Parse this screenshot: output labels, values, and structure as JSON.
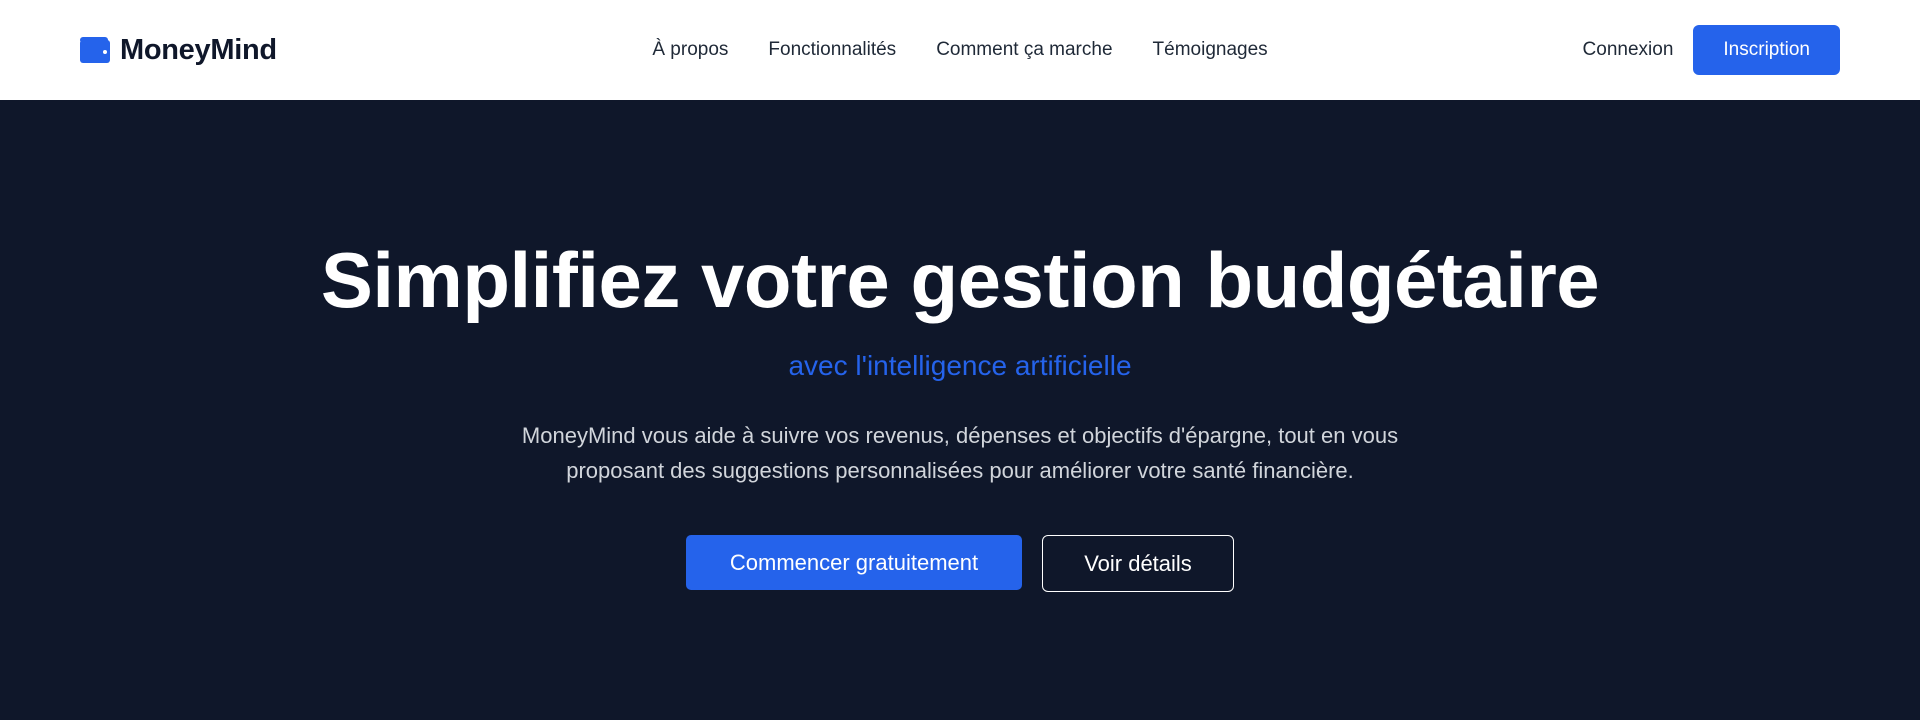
{
  "brand": {
    "name": "MoneyMind",
    "icon": "wallet-icon",
    "color": "#2563eb"
  },
  "nav": {
    "links": [
      {
        "label": "À propos"
      },
      {
        "label": "Fonctionnalités"
      },
      {
        "label": "Comment ça marche"
      },
      {
        "label": "Témoignages"
      }
    ],
    "login_label": "Connexion",
    "signup_label": "Inscription"
  },
  "hero": {
    "title": "Simplifiez votre gestion budgétaire",
    "subtitle": "avec l'intelligence artificielle",
    "description": "MoneyMind vous aide à suivre vos revenus, dépenses et objectifs d'épargne, tout en vous proposant des suggestions personnalisées pour améliorer votre santé financière.",
    "primary_cta": "Commencer gratuitement",
    "secondary_cta": "Voir détails"
  },
  "colors": {
    "accent": "#2563eb",
    "hero_background": "#0f172a",
    "navbar_background": "#ffffff"
  }
}
